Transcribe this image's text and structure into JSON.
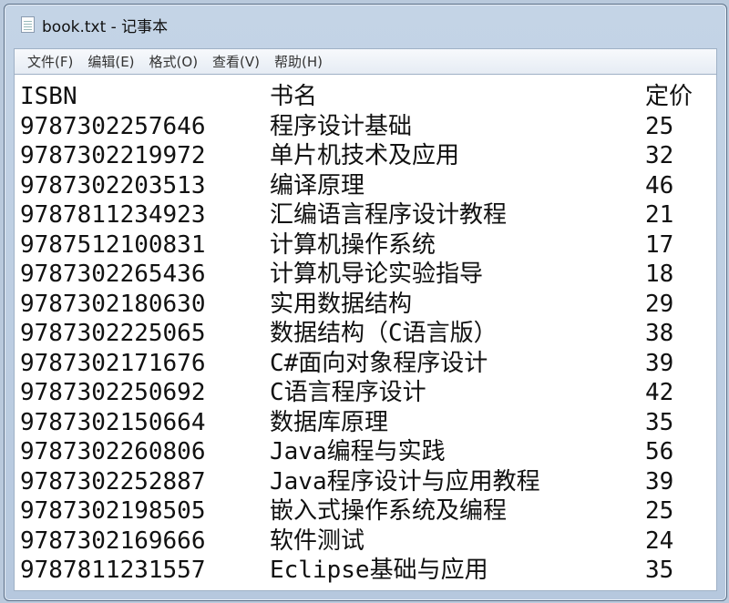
{
  "window": {
    "title": "book.txt - 记事本"
  },
  "menu": [
    "文件(F)",
    "编辑(E)",
    "格式(O)",
    "查看(V)",
    "帮助(H)"
  ],
  "content": {
    "header": {
      "isbn": "ISBN",
      "title": "书名",
      "price": "定价"
    },
    "rows": [
      {
        "isbn": "9787302257646",
        "title": "程序设计基础",
        "price": "25"
      },
      {
        "isbn": "9787302219972",
        "title": "单片机技术及应用",
        "price": "32"
      },
      {
        "isbn": "9787302203513",
        "title": "编译原理",
        "price": "46"
      },
      {
        "isbn": "9787811234923",
        "title": "汇编语言程序设计教程",
        "price": "21"
      },
      {
        "isbn": "9787512100831",
        "title": "计算机操作系统",
        "price": "17"
      },
      {
        "isbn": "9787302265436",
        "title": "计算机导论实验指导",
        "price": "18"
      },
      {
        "isbn": "9787302180630",
        "title": "实用数据结构",
        "price": "29"
      },
      {
        "isbn": "9787302225065",
        "title": "数据结构（C语言版）",
        "price": "38"
      },
      {
        "isbn": "9787302171676",
        "title": "C#面向对象程序设计",
        "price": "39"
      },
      {
        "isbn": "9787302250692",
        "title": "C语言程序设计",
        "price": "42"
      },
      {
        "isbn": "9787302150664",
        "title": "数据库原理",
        "price": "35"
      },
      {
        "isbn": "9787302260806",
        "title": "Java编程与实践",
        "price": "56"
      },
      {
        "isbn": "9787302252887",
        "title": "Java程序设计与应用教程",
        "price": "39"
      },
      {
        "isbn": "9787302198505",
        "title": "嵌入式操作系统及编程",
        "price": "25"
      },
      {
        "isbn": "9787302169666",
        "title": "软件测试",
        "price": "24"
      },
      {
        "isbn": "9787811231557",
        "title": "Eclipse基础与应用",
        "price": "35"
      }
    ]
  }
}
